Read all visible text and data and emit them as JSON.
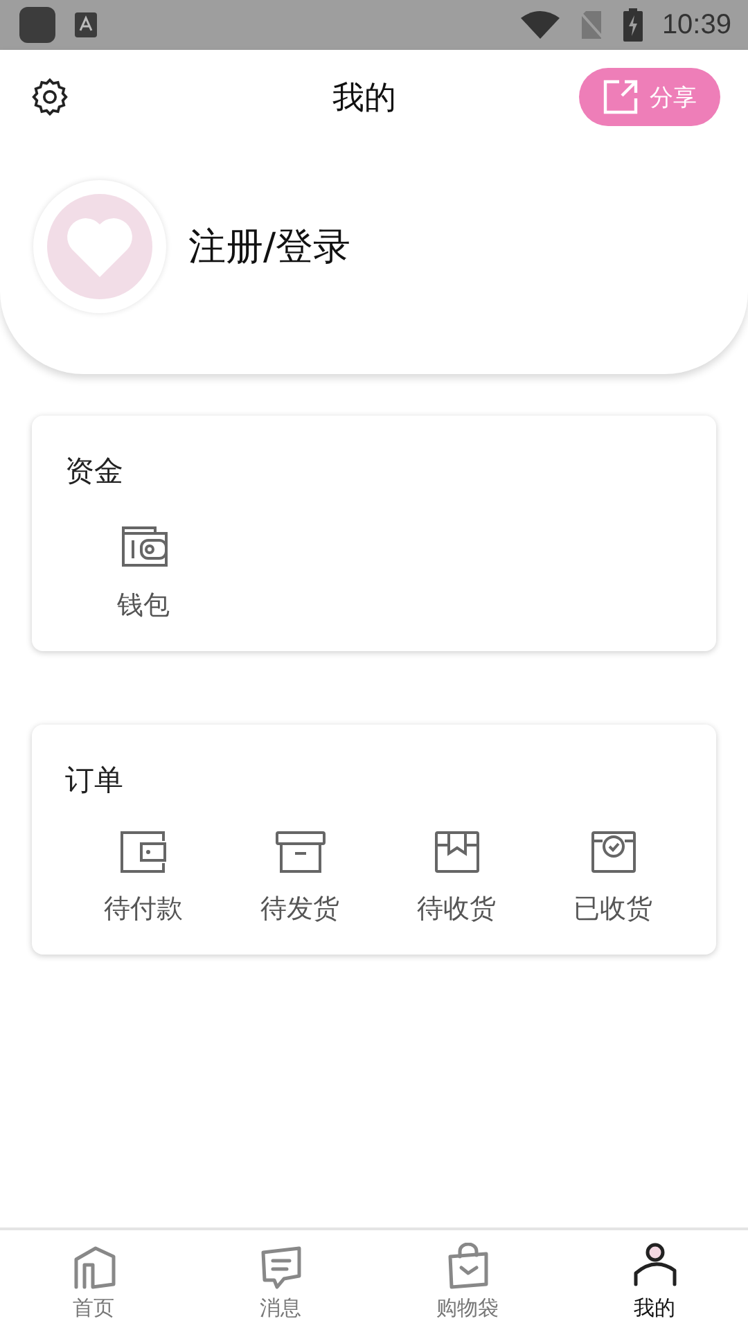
{
  "status_bar": {
    "time": "10:39"
  },
  "header": {
    "title": "我的",
    "share_label": "分享"
  },
  "profile": {
    "login_label": "注册/登录"
  },
  "sections": [
    {
      "title": "资金",
      "items": [
        {
          "label": "钱包"
        }
      ]
    },
    {
      "title": "订单",
      "items": [
        {
          "label": "待付款"
        },
        {
          "label": "待发货"
        },
        {
          "label": "待收货"
        },
        {
          "label": "已收货"
        }
      ]
    }
  ],
  "tabs": [
    {
      "label": "首页",
      "selected": false
    },
    {
      "label": "消息",
      "selected": false
    },
    {
      "label": "购物袋",
      "selected": false
    },
    {
      "label": "我的",
      "selected": true
    }
  ]
}
